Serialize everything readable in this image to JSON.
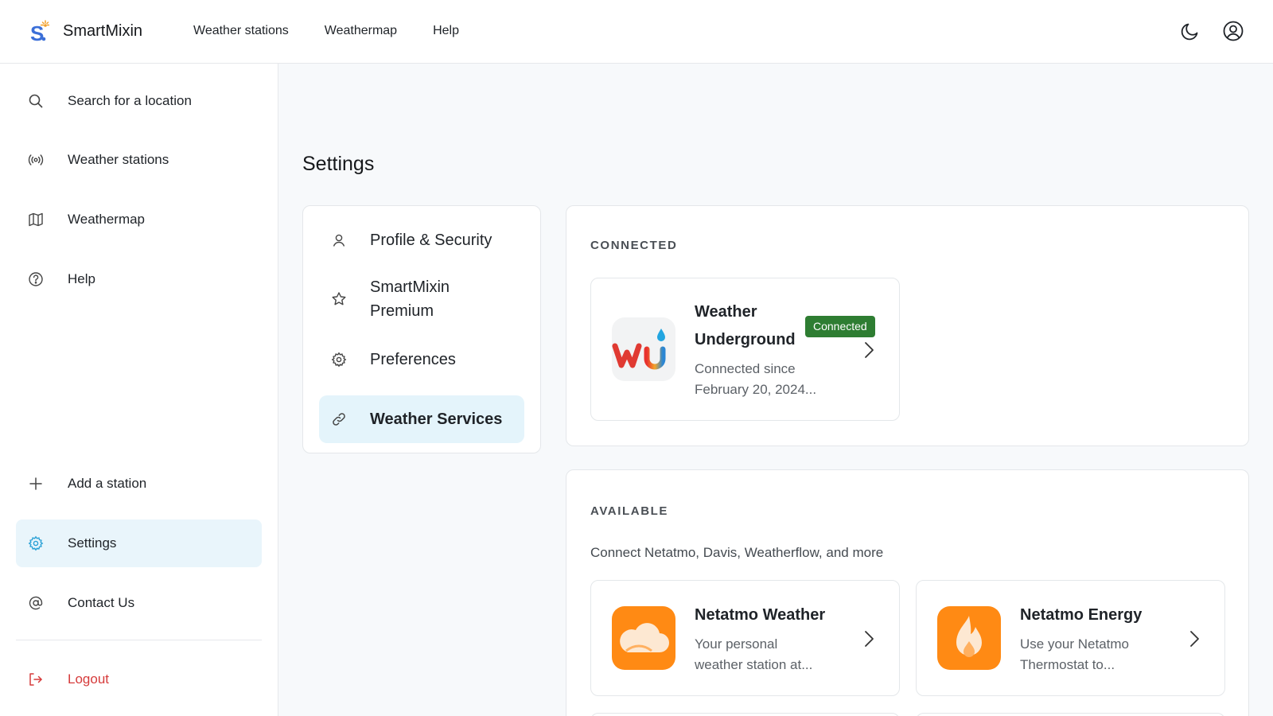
{
  "app": {
    "name": "SmartMixin"
  },
  "topnav": {
    "items": [
      {
        "label": "Weather stations"
      },
      {
        "label": "Weathermap"
      },
      {
        "label": "Help"
      }
    ]
  },
  "sidebar": {
    "items": [
      {
        "label": "Search for a location",
        "icon": "search-icon"
      },
      {
        "label": "Weather stations",
        "icon": "broadcast-icon"
      },
      {
        "label": "Weathermap",
        "icon": "map-icon"
      },
      {
        "label": "Help",
        "icon": "help-circle-icon"
      }
    ],
    "bottom": [
      {
        "label": "Add a station",
        "icon": "plus-icon"
      },
      {
        "label": "Settings",
        "icon": "gear-icon",
        "active": true
      },
      {
        "label": "Contact Us",
        "icon": "at-icon"
      }
    ],
    "logout": {
      "label": "Logout",
      "icon": "logout-icon"
    }
  },
  "main": {
    "title": "Settings",
    "settings_nav": [
      {
        "label": "Profile & Security",
        "icon": "user-icon"
      },
      {
        "label_line1": "SmartMixin",
        "label_line2": "Premium",
        "icon": "star-icon"
      },
      {
        "label": "Preferences",
        "icon": "gear-icon"
      },
      {
        "label": "Weather Services",
        "icon": "link-icon",
        "active": true
      }
    ],
    "connected": {
      "title": "CONNECTED",
      "services": [
        {
          "name_line1": "Weather",
          "name_line2": "Underground",
          "badge": "Connected",
          "desc_line1": "Connected since",
          "desc_line2": "February 20, 2024..."
        }
      ]
    },
    "available": {
      "title": "AVAILABLE",
      "subtitle": "Connect Netatmo, Davis, Weatherflow, and more",
      "services": [
        {
          "name": "Netatmo Weather",
          "desc_line1": "Your personal",
          "desc_line2": "weather station at..."
        },
        {
          "name": "Netatmo Energy",
          "desc_line1": "Use your Netatmo",
          "desc_line2": "Thermostat to..."
        }
      ]
    }
  },
  "colors": {
    "accent": "#2aa1d6",
    "active_bg": "#e9f5fb",
    "logout": "#d63b3b",
    "badge": "#2e7d32",
    "netatmo_orange": "#ff8a14"
  }
}
